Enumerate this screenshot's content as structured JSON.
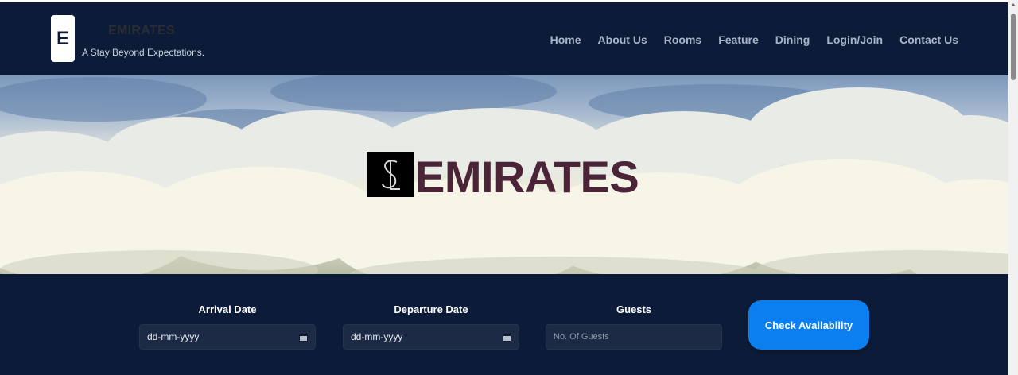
{
  "header": {
    "logo_letter": "E",
    "brand_name": "EMIRATES",
    "tagline": "A Stay Beyond Expectations.",
    "nav": [
      {
        "label": "Home"
      },
      {
        "label": "About Us"
      },
      {
        "label": "Rooms"
      },
      {
        "label": "Feature"
      },
      {
        "label": "Dining"
      },
      {
        "label": "Login/Join"
      },
      {
        "label": "Contact Us"
      }
    ]
  },
  "hero": {
    "logo_icon": "monogram-logo-icon",
    "title": "EMIRATES"
  },
  "booking": {
    "arrival": {
      "label": "Arrival Date",
      "value": "dd-mm-yyyy"
    },
    "departure": {
      "label": "Departure Date",
      "value": "dd-mm-yyyy"
    },
    "guests": {
      "label": "Guests",
      "placeholder": "No. Of Guests"
    },
    "submit_label": "Check Availability"
  },
  "colors": {
    "header_bg": "#0c1b37",
    "accent": "#0b7ef0",
    "hero_title": "#4b2537"
  }
}
